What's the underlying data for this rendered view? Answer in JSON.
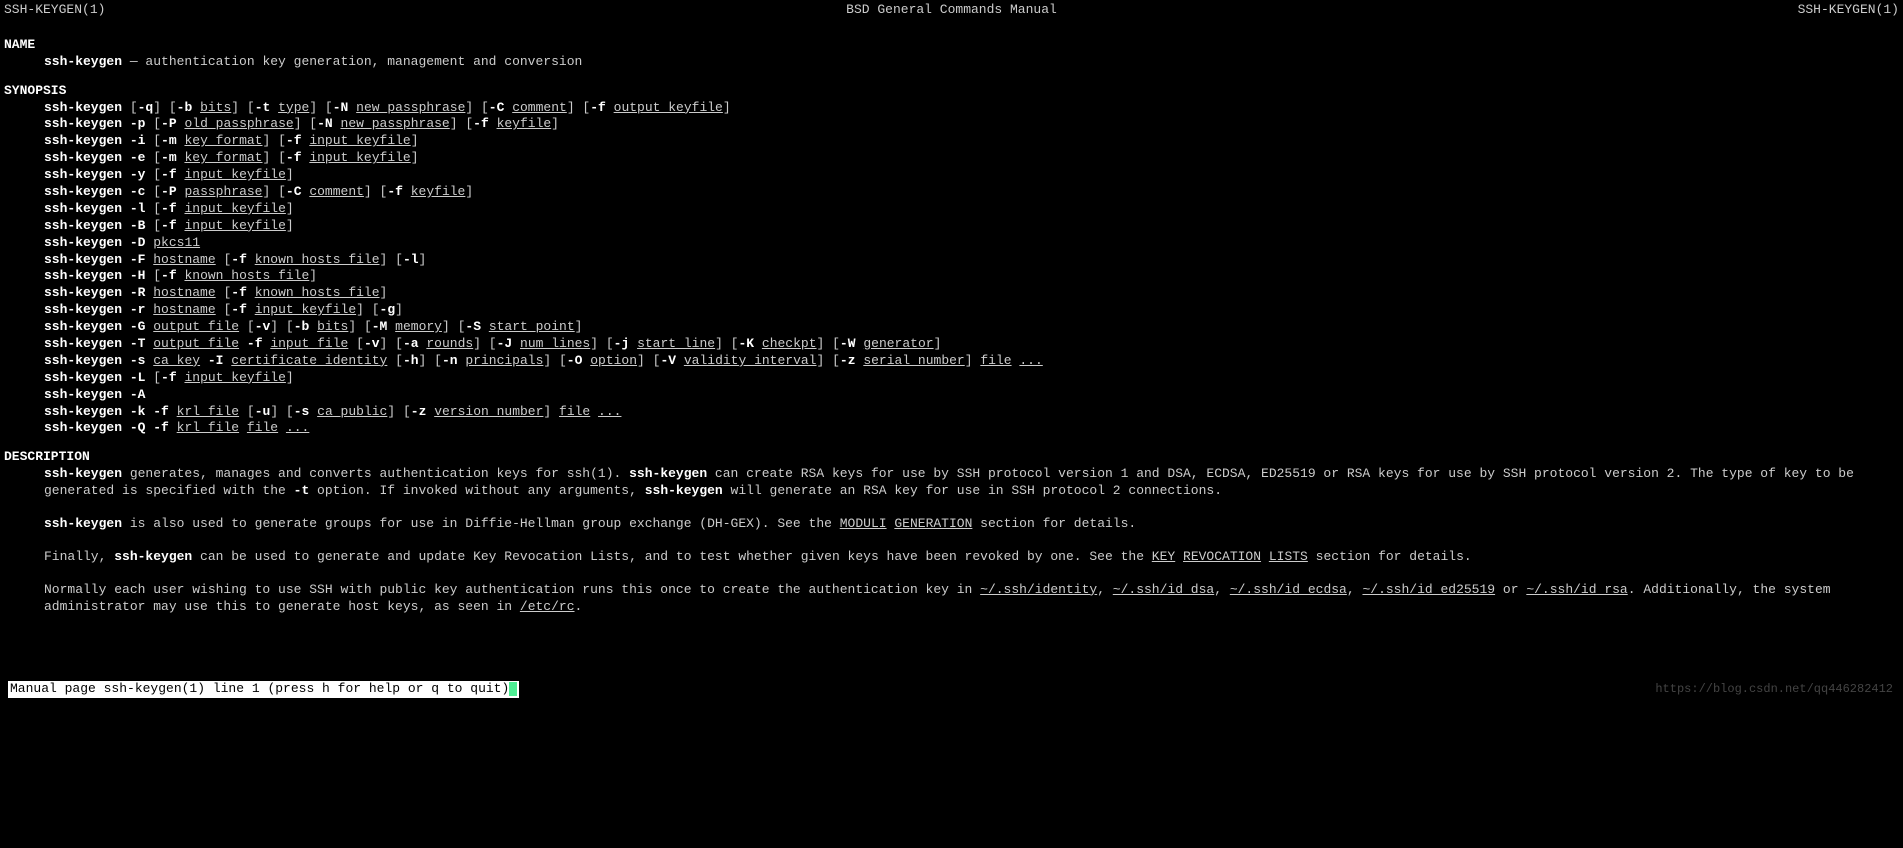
{
  "header": {
    "left": "SSH-KEYGEN(1)",
    "center": "BSD General Commands Manual",
    "right": "SSH-KEYGEN(1)"
  },
  "sections": {
    "name_title": "NAME",
    "name_cmd": "ssh-keygen",
    "name_desc": " — authentication key generation, management and conversion",
    "synopsis_title": "SYNOPSIS",
    "description_title": "DESCRIPTION"
  },
  "synopsis": [
    {
      "cmd": "ssh-keygen",
      "rest": [
        " [",
        {
          "b": "-q"
        },
        "] [",
        {
          "b": "-b"
        },
        " ",
        {
          "u": "bits"
        },
        "] [",
        {
          "b": "-t"
        },
        " ",
        {
          "u": "type"
        },
        "] [",
        {
          "b": "-N"
        },
        " ",
        {
          "u": "new_passphrase"
        },
        "] [",
        {
          "b": "-C"
        },
        " ",
        {
          "u": "comment"
        },
        "] [",
        {
          "b": "-f"
        },
        " ",
        {
          "u": "output_keyfile"
        },
        "]"
      ]
    },
    {
      "cmd": "ssh-keygen",
      "rest": [
        " ",
        {
          "b": "-p"
        },
        " [",
        {
          "b": "-P"
        },
        " ",
        {
          "u": "old_passphrase"
        },
        "] [",
        {
          "b": "-N"
        },
        " ",
        {
          "u": "new_passphrase"
        },
        "] [",
        {
          "b": "-f"
        },
        " ",
        {
          "u": "keyfile"
        },
        "]"
      ]
    },
    {
      "cmd": "ssh-keygen",
      "rest": [
        " ",
        {
          "b": "-i"
        },
        " [",
        {
          "b": "-m"
        },
        " ",
        {
          "u": "key_format"
        },
        "] [",
        {
          "b": "-f"
        },
        " ",
        {
          "u": "input_keyfile"
        },
        "]"
      ]
    },
    {
      "cmd": "ssh-keygen",
      "rest": [
        " ",
        {
          "b": "-e"
        },
        " [",
        {
          "b": "-m"
        },
        " ",
        {
          "u": "key_format"
        },
        "] [",
        {
          "b": "-f"
        },
        " ",
        {
          "u": "input_keyfile"
        },
        "]"
      ]
    },
    {
      "cmd": "ssh-keygen",
      "rest": [
        " ",
        {
          "b": "-y"
        },
        " [",
        {
          "b": "-f"
        },
        " ",
        {
          "u": "input_keyfile"
        },
        "]"
      ]
    },
    {
      "cmd": "ssh-keygen",
      "rest": [
        " ",
        {
          "b": "-c"
        },
        " [",
        {
          "b": "-P"
        },
        " ",
        {
          "u": "passphrase"
        },
        "] [",
        {
          "b": "-C"
        },
        " ",
        {
          "u": "comment"
        },
        "] [",
        {
          "b": "-f"
        },
        " ",
        {
          "u": "keyfile"
        },
        "]"
      ]
    },
    {
      "cmd": "ssh-keygen",
      "rest": [
        " ",
        {
          "b": "-l"
        },
        " [",
        {
          "b": "-f"
        },
        " ",
        {
          "u": "input_keyfile"
        },
        "]"
      ]
    },
    {
      "cmd": "ssh-keygen",
      "rest": [
        " ",
        {
          "b": "-B"
        },
        " [",
        {
          "b": "-f"
        },
        " ",
        {
          "u": "input_keyfile"
        },
        "]"
      ]
    },
    {
      "cmd": "ssh-keygen",
      "rest": [
        " ",
        {
          "b": "-D"
        },
        " ",
        {
          "u": "pkcs11"
        }
      ]
    },
    {
      "cmd": "ssh-keygen",
      "rest": [
        " ",
        {
          "b": "-F"
        },
        " ",
        {
          "u": "hostname"
        },
        " [",
        {
          "b": "-f"
        },
        " ",
        {
          "u": "known_hosts_file"
        },
        "] [",
        {
          "b": "-l"
        },
        "]"
      ]
    },
    {
      "cmd": "ssh-keygen",
      "rest": [
        " ",
        {
          "b": "-H"
        },
        " [",
        {
          "b": "-f"
        },
        " ",
        {
          "u": "known_hosts_file"
        },
        "]"
      ]
    },
    {
      "cmd": "ssh-keygen",
      "rest": [
        " ",
        {
          "b": "-R"
        },
        " ",
        {
          "u": "hostname"
        },
        " [",
        {
          "b": "-f"
        },
        " ",
        {
          "u": "known_hosts_file"
        },
        "]"
      ]
    },
    {
      "cmd": "ssh-keygen",
      "rest": [
        " ",
        {
          "b": "-r"
        },
        " ",
        {
          "u": "hostname"
        },
        " [",
        {
          "b": "-f"
        },
        " ",
        {
          "u": "input_keyfile"
        },
        "] [",
        {
          "b": "-g"
        },
        "]"
      ]
    },
    {
      "cmd": "ssh-keygen",
      "rest": [
        " ",
        {
          "b": "-G"
        },
        " ",
        {
          "u": "output_file"
        },
        " [",
        {
          "b": "-v"
        },
        "] [",
        {
          "b": "-b"
        },
        " ",
        {
          "u": "bits"
        },
        "] [",
        {
          "b": "-M"
        },
        " ",
        {
          "u": "memory"
        },
        "] [",
        {
          "b": "-S"
        },
        " ",
        {
          "u": "start_point"
        },
        "]"
      ]
    },
    {
      "cmd": "ssh-keygen",
      "rest": [
        " ",
        {
          "b": "-T"
        },
        " ",
        {
          "u": "output_file"
        },
        " ",
        {
          "b": "-f"
        },
        " ",
        {
          "u": "input_file"
        },
        " [",
        {
          "b": "-v"
        },
        "] [",
        {
          "b": "-a"
        },
        " ",
        {
          "u": "rounds"
        },
        "] [",
        {
          "b": "-J"
        },
        " ",
        {
          "u": "num_lines"
        },
        "] [",
        {
          "b": "-j"
        },
        " ",
        {
          "u": "start_line"
        },
        "] [",
        {
          "b": "-K"
        },
        " ",
        {
          "u": "checkpt"
        },
        "] [",
        {
          "b": "-W"
        },
        " ",
        {
          "u": "generator"
        },
        "]"
      ]
    },
    {
      "cmd": "ssh-keygen",
      "rest": [
        " ",
        {
          "b": "-s"
        },
        " ",
        {
          "u": "ca_key"
        },
        " ",
        {
          "b": "-I"
        },
        " ",
        {
          "u": "certificate_identity"
        },
        " [",
        {
          "b": "-h"
        },
        "] [",
        {
          "b": "-n"
        },
        " ",
        {
          "u": "principals"
        },
        "] [",
        {
          "b": "-O"
        },
        " ",
        {
          "u": "option"
        },
        "] [",
        {
          "b": "-V"
        },
        " ",
        {
          "u": "validity_interval"
        },
        "] [",
        {
          "b": "-z"
        },
        " ",
        {
          "u": "serial_number"
        },
        "] ",
        {
          "u": "file"
        },
        " ",
        {
          "u": "..."
        }
      ]
    },
    {
      "cmd": "ssh-keygen",
      "rest": [
        " ",
        {
          "b": "-L"
        },
        " [",
        {
          "b": "-f"
        },
        " ",
        {
          "u": "input_keyfile"
        },
        "]"
      ]
    },
    {
      "cmd": "ssh-keygen",
      "rest": [
        " ",
        {
          "b": "-A"
        }
      ]
    },
    {
      "cmd": "ssh-keygen",
      "rest": [
        " ",
        {
          "b": "-k"
        },
        " ",
        {
          "b": "-f"
        },
        " ",
        {
          "u": "krl_file"
        },
        " [",
        {
          "b": "-u"
        },
        "] [",
        {
          "b": "-s"
        },
        " ",
        {
          "u": "ca_public"
        },
        "] [",
        {
          "b": "-z"
        },
        " ",
        {
          "u": "version_number"
        },
        "] ",
        {
          "u": "file"
        },
        " ",
        {
          "u": "..."
        }
      ]
    },
    {
      "cmd": "ssh-keygen",
      "rest": [
        " ",
        {
          "b": "-Q"
        },
        " ",
        {
          "b": "-f"
        },
        " ",
        {
          "u": "krl_file"
        },
        " ",
        {
          "u": "file"
        },
        " ",
        {
          "u": "..."
        }
      ]
    }
  ],
  "description": {
    "p1_parts": [
      {
        "b": "ssh-keygen"
      },
      " generates, manages and converts authentication keys for ssh(1).  ",
      {
        "b": "ssh-keygen"
      },
      " can create RSA keys for use by SSH protocol version 1 and DSA, ECDSA, ED25519 or RSA keys for use by SSH protocol version 2.  The type of key to be generated is specified with the ",
      {
        "b": "-t"
      },
      " option.  If invoked without any arguments, ",
      {
        "b": "ssh-keygen"
      },
      " will generate an RSA key for use in SSH protocol 2 connections."
    ],
    "p2_parts": [
      {
        "b": "ssh-keygen"
      },
      " is also used to generate groups for use in Diffie-Hellman group exchange (DH-GEX).  See the ",
      {
        "u": "MODULI"
      },
      " ",
      {
        "u": "GENERATION"
      },
      " section for details."
    ],
    "p3_parts": [
      "Finally, ",
      {
        "b": "ssh-keygen"
      },
      " can be used to generate and update Key Revocation Lists, and to test whether given keys have been revoked by one.  See the ",
      {
        "u": "KEY"
      },
      " ",
      {
        "u": "REVOCATION"
      },
      " ",
      {
        "u": "LISTS"
      },
      " section for details."
    ],
    "p4_parts": [
      "Normally each user wishing to use SSH with public key authentication runs this once to create the authentication key in ",
      {
        "u": "~/.ssh/identity"
      },
      ", ",
      {
        "u": "~/.ssh/id_dsa"
      },
      ", ",
      {
        "u": "~/.ssh/id_ecdsa"
      },
      ", ",
      {
        "u": "~/.ssh/id_ed25519"
      },
      " or ",
      {
        "u": "~/.ssh/id_rsa"
      },
      ".  Additionally, the system administrator may use this to generate host keys, as seen in ",
      {
        "u": "/etc/rc"
      },
      "."
    ]
  },
  "status": " Manual page ssh-keygen(1) line 1 (press h for help or q to quit)",
  "watermark": "https://blog.csdn.net/qq446282412"
}
